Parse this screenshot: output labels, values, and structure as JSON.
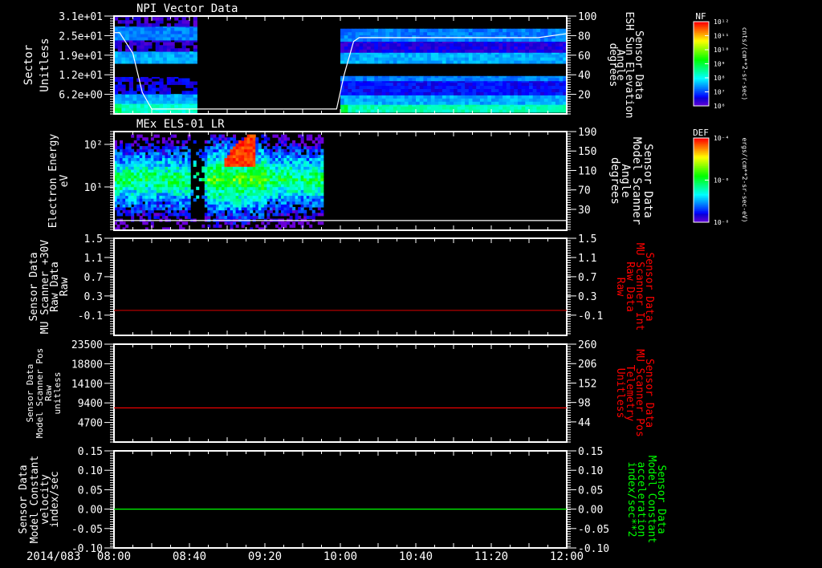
{
  "date_label": "2014/083",
  "time_axis": {
    "range": [
      "08:00",
      "12:00"
    ],
    "labels": [
      "08:00",
      "08:40",
      "09:20",
      "10:00",
      "10:40",
      "11:20",
      "12:00"
    ]
  },
  "colorbars": [
    {
      "title": "NF",
      "ticks": [
        "10¹²",
        "10¹¹",
        "10¹⁰",
        "10⁹",
        "10⁸",
        "10⁷",
        "10⁶"
      ],
      "unit": "cnts/(cm**2-sr-sec)"
    },
    {
      "title": "DEF",
      "ticks": [
        "10⁻⁴",
        "10⁻⁶",
        "10⁻⁸"
      ],
      "unit": "ergs/(cm**2-sr-sec-eV)"
    }
  ],
  "chart_data": [
    {
      "type": "heatmap",
      "title": "NPI Vector Data",
      "left_label": [
        "Sector",
        "Unitless"
      ],
      "right_label": [
        "Sensor Data",
        "ESH Sun Elevation",
        "Angle",
        "degrees"
      ],
      "ylim": [
        0,
        31
      ],
      "yticks": [
        {
          "v": 31,
          "label": "3.1e+01"
        },
        {
          "v": 24.8,
          "label": "2.5e+01"
        },
        {
          "v": 18.6,
          "label": "1.9e+01"
        },
        {
          "v": 12.4,
          "label": "1.2e+01"
        },
        {
          "v": 6.2,
          "label": "6.2e+00"
        }
      ],
      "y2lim": [
        0,
        100
      ],
      "y2ticks": [
        {
          "v": 100,
          "label": "100"
        },
        {
          "v": 80,
          "label": "80"
        },
        {
          "v": 60,
          "label": "60"
        },
        {
          "v": 40,
          "label": "40"
        },
        {
          "v": 20,
          "label": "20"
        }
      ],
      "colorbar": "NF",
      "blocks": [
        {
          "time": [
            "08:00",
            "08:44"
          ],
          "bands": [
            {
              "sectors": [
                0,
                3.3
              ],
              "level": 0.38
            },
            {
              "sectors": [
                3.3,
                6.3
              ],
              "level": 0.26
            },
            {
              "sectors": [
                6.3,
                11.7
              ],
              "level": 0.1,
              "sparse": true
            },
            {
              "sectors": [
                16,
                19.8
              ],
              "level": 0.26
            },
            {
              "sectors": [
                19.8,
                23.4
              ],
              "level": 0.06,
              "sparse": true
            },
            {
              "sectors": [
                23.4,
                27.7
              ],
              "level": 0.22
            },
            {
              "sectors": [
                27.7,
                31
              ],
              "level": 0.05,
              "sparse": true
            }
          ]
        },
        {
          "time": [
            "10:00",
            "12:00"
          ],
          "bands": [
            {
              "sectors": [
                0.5,
                3
              ],
              "level": 0.4
            },
            {
              "sectors": [
                3,
                6
              ],
              "level": 0.26
            },
            {
              "sectors": [
                6,
                10.5
              ],
              "level": 0.12
            },
            {
              "sectors": [
                10.5,
                12
              ],
              "level": 0.22
            },
            {
              "sectors": [
                16,
                19.5
              ],
              "level": 0.26
            },
            {
              "sectors": [
                19.5,
                23
              ],
              "level": 0.08
            },
            {
              "sectors": [
                23,
                27
              ],
              "level": 0.22
            }
          ]
        }
      ],
      "line": {
        "name": "ESH Sun Elevation Angle",
        "color": "#ffffff",
        "points": [
          [
            "08:00",
            83
          ],
          [
            "08:03",
            83
          ],
          [
            "08:10",
            62
          ],
          [
            "08:15",
            22
          ],
          [
            "08:20",
            5
          ],
          [
            "09:58",
            5
          ],
          [
            "10:02",
            40
          ],
          [
            "10:07",
            74
          ],
          [
            "10:10",
            78
          ],
          [
            "11:45",
            78
          ],
          [
            "12:00",
            82
          ]
        ]
      }
    },
    {
      "type": "heatmap",
      "title": "MEx ELS-01 LR",
      "left_label": [
        "Electron Energy",
        "eV"
      ],
      "right_label": [
        "Sensor Data",
        "Model Scanner",
        "Angle",
        "degrees"
      ],
      "yscale": "log",
      "ylim": [
        0.96,
        200
      ],
      "yticks": [
        {
          "v": 100,
          "label": "10²"
        },
        {
          "v": 10,
          "label": "10¹"
        }
      ],
      "y2lim": [
        -13,
        190
      ],
      "y2ticks": [
        {
          "v": 190,
          "label": "190"
        },
        {
          "v": 150,
          "label": "150"
        },
        {
          "v": 110,
          "label": "110"
        },
        {
          "v": 70,
          "label": "70"
        },
        {
          "v": 30,
          "label": "30"
        }
      ],
      "colorbar": "DEF",
      "data_time": [
        "08:00",
        "09:50"
      ],
      "core_energy_eV": 15,
      "gap_time": [
        "08:40",
        "08:48"
      ],
      "enhancement": {
        "time": [
          "08:58",
          "09:14"
        ],
        "energy_eV": [
          30,
          160
        ]
      },
      "line": {
        "name": "Model Scanner Angle",
        "color": "#ffffff",
        "value": 7
      }
    },
    {
      "type": "line",
      "left_label": [
        "Sensor Data",
        "MU Scanner +30V",
        "Raw Data",
        "Raw"
      ],
      "right_label": [
        "Sensor Data",
        "MU Scanner Int",
        "Raw Data",
        "Raw"
      ],
      "right_label_color": "#ff0000",
      "ylim": [
        -0.52,
        1.5
      ],
      "yticks": [
        {
          "v": 1.5,
          "label": "1.5"
        },
        {
          "v": 1.1,
          "label": "1.1"
        },
        {
          "v": 0.7,
          "label": "0.7"
        },
        {
          "v": 0.3,
          "label": "0.3"
        },
        {
          "v": -0.1,
          "label": "-0.1"
        }
      ],
      "y2ticks": [
        {
          "v": 1.5,
          "label": "1.5"
        },
        {
          "v": 1.1,
          "label": "1.1"
        },
        {
          "v": 0.7,
          "label": "0.7"
        },
        {
          "v": 0.3,
          "label": "0.3"
        },
        {
          "v": -0.1,
          "label": "-0.1"
        }
      ],
      "line": {
        "color": "#b00000",
        "value": 0.0
      }
    },
    {
      "type": "line",
      "left_label": [
        "Sensor Data",
        "Model Scanner Pos",
        "Raw",
        "unitless"
      ],
      "right_label": [
        "Sensor Data",
        "MU Scanner Pos",
        "Telemetry",
        "Unitless"
      ],
      "right_label_color": "#ff0000",
      "ylim": [
        0,
        23500
      ],
      "yticks": [
        {
          "v": 23500,
          "label": "23500"
        },
        {
          "v": 18800,
          "label": "18800"
        },
        {
          "v": 14100,
          "label": "14100"
        },
        {
          "v": 9400,
          "label": "9400"
        },
        {
          "v": 4700,
          "label": "4700"
        }
      ],
      "y2lim": [
        -12,
        260
      ],
      "y2ticks": [
        {
          "v": 260,
          "label": "260"
        },
        {
          "v": 206,
          "label": "206"
        },
        {
          "v": 152,
          "label": "152"
        },
        {
          "v": 98,
          "label": "98"
        },
        {
          "v": 44,
          "label": "44"
        }
      ],
      "line": {
        "color": "#ff0000",
        "value": 8200
      }
    },
    {
      "type": "line",
      "left_label": [
        "Sensor Data",
        "Model Constant",
        "velocity",
        "index/sec"
      ],
      "right_label": [
        "Sensor Data",
        "Model Constant",
        "acceleration",
        "index/sec**2"
      ],
      "right_label_color": "#00ff00",
      "ylim": [
        -0.1,
        0.15
      ],
      "yticks": [
        {
          "v": 0.15,
          "label": "0.15"
        },
        {
          "v": 0.1,
          "label": "0.10"
        },
        {
          "v": 0.05,
          "label": "0.05"
        },
        {
          "v": 0.0,
          "label": "0.00"
        },
        {
          "v": -0.05,
          "label": "-0.05"
        },
        {
          "v": -0.1,
          "label": "-0.10"
        }
      ],
      "y2ticks": [
        {
          "v": 0.15,
          "label": "0.15"
        },
        {
          "v": 0.1,
          "label": "0.10"
        },
        {
          "v": 0.05,
          "label": "0.05"
        },
        {
          "v": 0.0,
          "label": "0.00"
        },
        {
          "v": -0.05,
          "label": "-0.05"
        },
        {
          "v": -0.1,
          "label": "-0.10"
        }
      ],
      "line": {
        "color": "#00ff00",
        "value": 0.0
      }
    }
  ]
}
